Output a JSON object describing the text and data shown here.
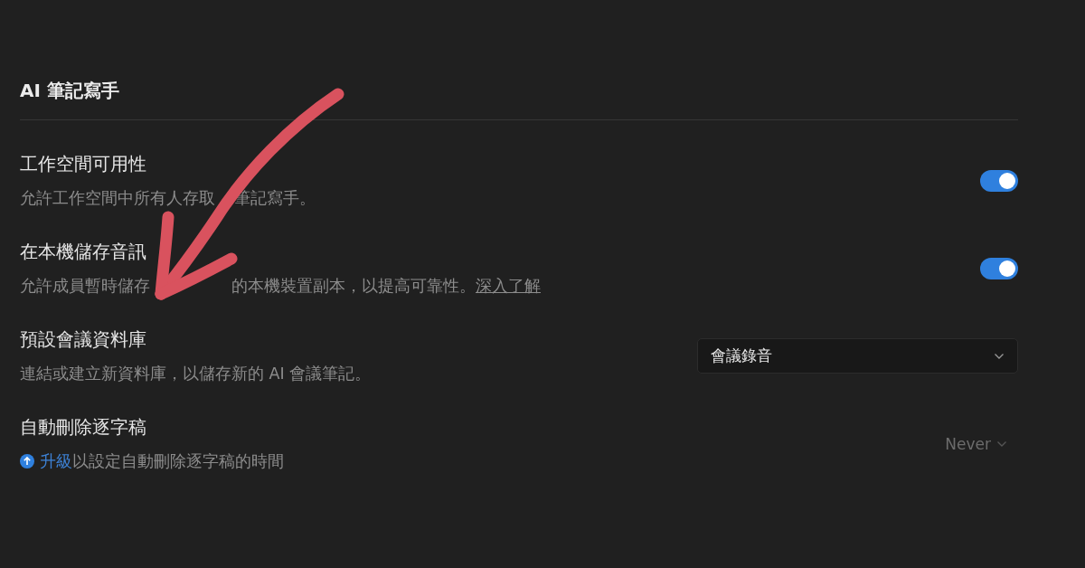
{
  "section_title": "AI 筆記寫手",
  "settings": [
    {
      "kind": "toggle",
      "label": "工作空間可用性",
      "description": [
        "允許工作空間中所有人存取",
        "筆記寫手。"
      ],
      "on": true
    },
    {
      "kind": "toggle",
      "label": "在本機儲存音訊",
      "description": [
        "允許成員暫時儲存",
        "的本機裝置副本，以提高可靠性。"
      ],
      "link": "深入了解",
      "on": true
    },
    {
      "kind": "select",
      "label": "預設會議資料庫",
      "description": [
        "連結或建立新資料庫，以儲存新的 AI 會議筆記。"
      ],
      "value": "會議錄音",
      "disabled": false
    },
    {
      "kind": "select",
      "label": "自動刪除逐字稿",
      "upgrade_link": "升級",
      "description": [
        "以設定自動刪除逐字稿的時間"
      ],
      "value": "Never",
      "disabled": true
    }
  ]
}
